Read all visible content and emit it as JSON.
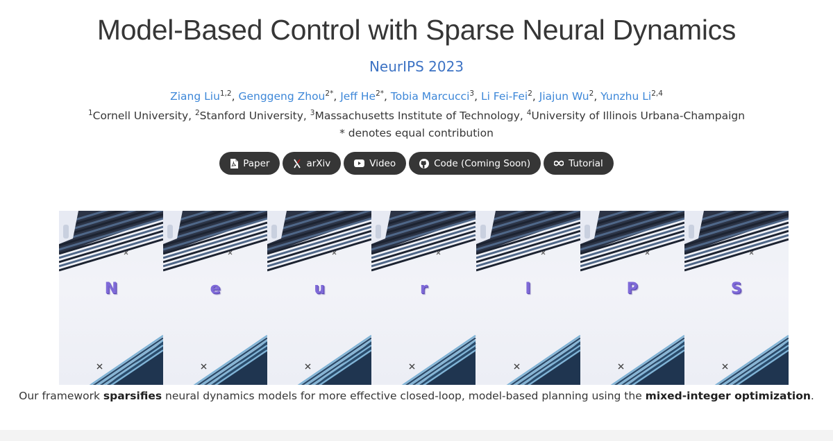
{
  "title": "Model-Based Control with Sparse Neural Dynamics",
  "venue": "NeurIPS 2023",
  "authors": [
    {
      "name": "Ziang Liu",
      "sup": "1,2",
      "sep": ", "
    },
    {
      "name": "Genggeng Zhou",
      "sup": "2*",
      "sep": ", "
    },
    {
      "name": "Jeff He",
      "sup": "2*",
      "sep": ", "
    },
    {
      "name": "Tobia Marcucci",
      "sup": "3",
      "sep": ", "
    },
    {
      "name": "Li Fei-Fei",
      "sup": "2",
      "sep": ", "
    },
    {
      "name": "Jiajun Wu",
      "sup": "2",
      "sep": ", "
    },
    {
      "name": "Yunzhu Li",
      "sup": "2,4",
      "sep": ""
    }
  ],
  "affiliations": [
    {
      "sup": "1",
      "name": "Cornell University",
      "sep": ", "
    },
    {
      "sup": "2",
      "name": "Stanford University",
      "sep": ", "
    },
    {
      "sup": "3",
      "name": "Massachusetts Institute of Technology",
      "sep": ", "
    },
    {
      "sup": "4",
      "name": "University of Illinois Urbana-Champaign",
      "sep": ""
    }
  ],
  "equal_note": "* denotes equal contribution",
  "links": [
    {
      "label": "Paper",
      "icon": "pdf-icon"
    },
    {
      "label": "arXiv",
      "icon": "arxiv-icon"
    },
    {
      "label": "Video",
      "icon": "youtube-icon"
    },
    {
      "label": "Code (Coming Soon)",
      "icon": "github-icon"
    },
    {
      "label": "Tutorial",
      "icon": "infinity-icon"
    }
  ],
  "teaser_frames": [
    "N",
    "e",
    "u",
    "r",
    "I",
    "P",
    "S"
  ],
  "caption": {
    "pre": "Our framework ",
    "bold1": "sparsifies",
    "mid": " neural dynamics models for more effective closed-loop, model-based planning using the ",
    "bold2": "mixed-integer optimization",
    "post": "."
  },
  "colors": {
    "link": "#3d87d8",
    "venue": "#3d73c4",
    "button_bg": "#363636",
    "letter": "#7f6ad8"
  }
}
